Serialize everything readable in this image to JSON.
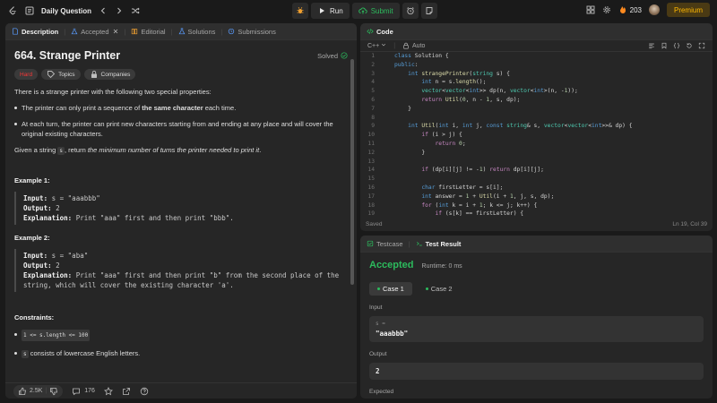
{
  "topbar": {
    "title": "Daily Question",
    "run_label": "Run",
    "submit_label": "Submit",
    "streak_count": "203",
    "premium_label": "Premium"
  },
  "description_tabs": [
    {
      "label": "Description"
    },
    {
      "label": "Accepted"
    },
    {
      "label": "Editorial"
    },
    {
      "label": "Solutions"
    },
    {
      "label": "Submissions"
    }
  ],
  "problem": {
    "title": "664. Strange Printer",
    "status": "Solved",
    "difficulty": "Hard",
    "topics_label": "Topics",
    "companies_label": "Companies",
    "intro": "There is a strange printer with the following two special properties:",
    "prop1_pre": "The printer can only print a sequence of ",
    "prop1_bold": "the same character",
    "prop1_post": " each time.",
    "prop2": "At each turn, the printer can print new characters starting from and ending at any place and will cover the original existing characters.",
    "given_pre": "Given a string ",
    "given_code": "s",
    "given_mid": ", return ",
    "given_em": "the minimum number of turns the printer needed to print it",
    "given_post": ".",
    "ex1_title": "Example 1:",
    "ex1_input_label": "Input:",
    "ex1_input": " s = \"aaabbb\"",
    "ex1_output_label": "Output:",
    "ex1_output": " 2",
    "ex1_expl_label": "Explanation:",
    "ex1_expl": " Print \"aaa\" first and then print \"bbb\".",
    "ex2_title": "Example 2:",
    "ex2_input_label": "Input:",
    "ex2_input": " s = \"aba\"",
    "ex2_output_label": "Output:",
    "ex2_output": " 2",
    "ex2_expl_label": "Explanation:",
    "ex2_expl": " Print \"aaa\" first and then print \"b\" from the second place of the string, which will cover the existing character 'a'.",
    "constraints_title": "Constraints:",
    "c1": "1 <= s.length <= 100",
    "c2_code": "s",
    "c2_text": " consists of lowercase English letters."
  },
  "footer": {
    "likes": "2.5K",
    "comments": "176"
  },
  "code_panel": {
    "tab_label": "Code",
    "language": "C++",
    "mode": "Auto",
    "saved": "Saved",
    "cursor": "Ln 19, Col 39",
    "lines": [
      {
        "n": "1",
        "t": "class Solution {"
      },
      {
        "n": "2",
        "t": "public:"
      },
      {
        "n": "3",
        "t": "    int strangePrinter(string s) {"
      },
      {
        "n": "4",
        "t": "        int n = s.length();"
      },
      {
        "n": "5",
        "t": "        vector<vector<int>> dp(n, vector<int>(n, -1));"
      },
      {
        "n": "6",
        "t": "        return Util(0, n - 1, s, dp);"
      },
      {
        "n": "7",
        "t": "    }"
      },
      {
        "n": "8",
        "t": ""
      },
      {
        "n": "9",
        "t": "    int Util(int i, int j, const string& s, vector<vector<int>>& dp) {"
      },
      {
        "n": "10",
        "t": "        if (i > j) {"
      },
      {
        "n": "11",
        "t": "            return 0;"
      },
      {
        "n": "12",
        "t": "        }"
      },
      {
        "n": "13",
        "t": ""
      },
      {
        "n": "14",
        "t": "        if (dp[i][j] != -1) return dp[i][j];"
      },
      {
        "n": "15",
        "t": ""
      },
      {
        "n": "16",
        "t": "        char firstLetter = s[i];"
      },
      {
        "n": "17",
        "t": "        int answer = 1 + Util(i + 1, j, s, dp);"
      },
      {
        "n": "18",
        "t": "        for (int k = i + 1; k <= j; k++) {"
      },
      {
        "n": "19",
        "t": "            if (s[k] == firstLetter) {"
      }
    ]
  },
  "result_panel": {
    "testcase_label": "Testcase",
    "result_label": "Test Result",
    "verdict": "Accepted",
    "runtime": "Runtime: 0 ms",
    "case1": "Case 1",
    "case2": "Case 2",
    "input_label": "Input",
    "var_name": "s =",
    "var_value": "\"aaabbb\"",
    "output_label": "Output",
    "output_value": "2",
    "expected_label": "Expected"
  },
  "colors": {
    "accent_green": "#2cbb5d",
    "hard_red": "#f63737",
    "premium_gold": "#ffb800",
    "debug_orange": "#f0a030"
  }
}
